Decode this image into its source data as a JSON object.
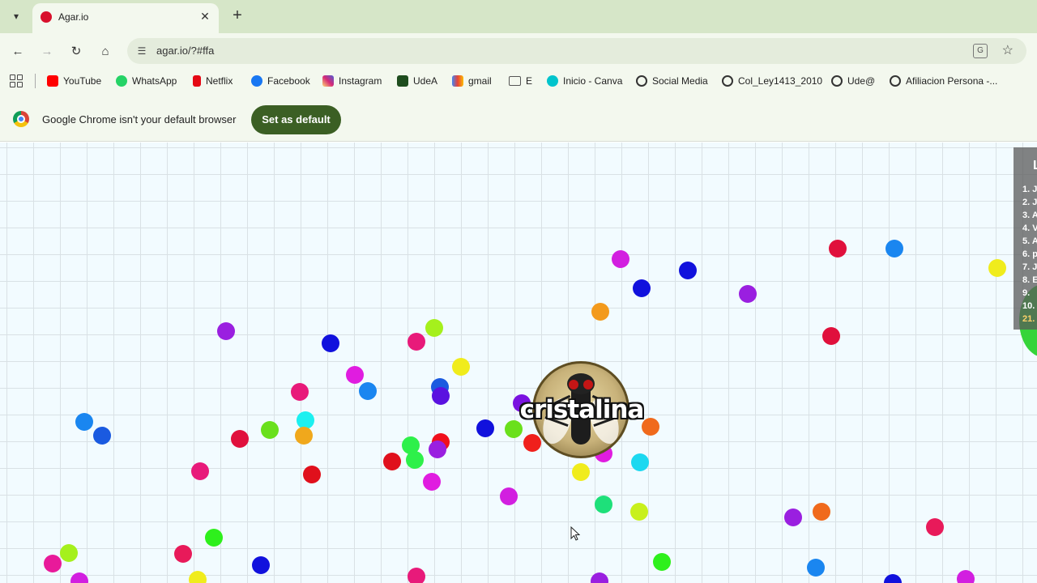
{
  "browser": {
    "tab": {
      "title": "Agar.io"
    },
    "url": "agar.io/?#ffa",
    "bookmarks": [
      {
        "label": "YouTube",
        "icon": "youtube-icon",
        "color": "#ff0000"
      },
      {
        "label": "WhatsApp",
        "icon": "whatsapp-icon",
        "color": "#25d366"
      },
      {
        "label": "Netflix",
        "icon": "netflix-icon",
        "color": "#e50914"
      },
      {
        "label": "Facebook",
        "icon": "facebook-icon",
        "color": "#1877f2"
      },
      {
        "label": "Instagram",
        "icon": "instagram-icon",
        "color": "#d62976"
      },
      {
        "label": "UdeA",
        "icon": "udea-icon",
        "color": "#1e4d1e"
      },
      {
        "label": "gmail",
        "icon": "gmail-icon",
        "color": "#ea4335"
      },
      {
        "label": "E",
        "icon": "folder-icon",
        "color": "#555555"
      },
      {
        "label": "Inicio - Canva",
        "icon": "canva-icon",
        "color": "#00c4cc"
      },
      {
        "label": "Social Media",
        "icon": "globe-icon",
        "color": "#333333"
      },
      {
        "label": "Col_Ley1413_2010",
        "icon": "globe-icon",
        "color": "#333333"
      },
      {
        "label": "Ude@",
        "icon": "globe-icon",
        "color": "#333333"
      },
      {
        "label": "Afiliacion Persona -...",
        "icon": "globe-icon",
        "color": "#333333"
      }
    ],
    "infobar": {
      "message": "Google Chrome isn't your default browser",
      "button": "Set as default"
    }
  },
  "game": {
    "player_name": "cristalina",
    "leaderboard": {
      "title": "L",
      "entries": [
        "1. J",
        "2. J",
        "3. A",
        "4. V",
        "5. A",
        "6. p",
        "7. J",
        "8. E",
        "9.",
        "10.",
        "21."
      ]
    }
  }
}
